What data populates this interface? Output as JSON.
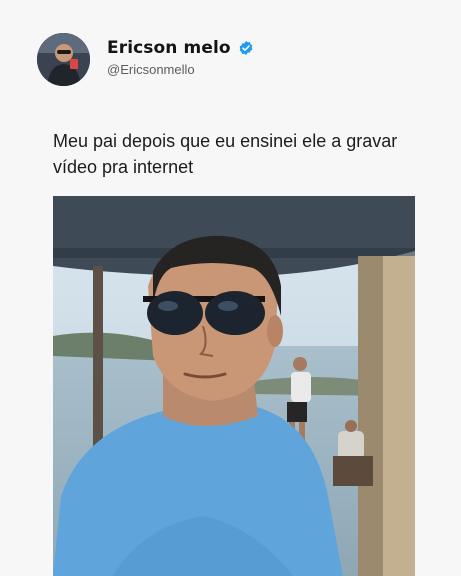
{
  "post": {
    "author": {
      "display_name": "Ericson melo",
      "handle": "@Ericsonmello",
      "verified": true,
      "verified_badge_color": "#1d9bf0"
    },
    "text": "Meu pai depois que eu ensinei ele a gravar vídeo pra internet",
    "media": {
      "type": "video-frame"
    }
  },
  "colors": {
    "background": "#f7f7f7",
    "name": "#141414",
    "handle": "#5c5c5c",
    "body_text": "#1c1c1c"
  }
}
